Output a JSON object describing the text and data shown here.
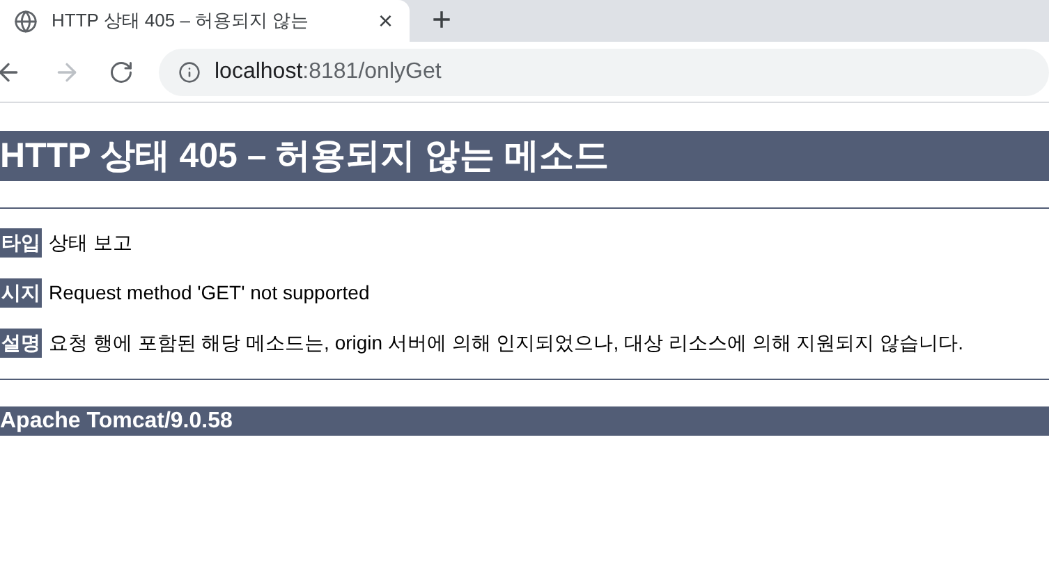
{
  "browser": {
    "tab": {
      "title": "HTTP 상태 405 – 허용되지 않는",
      "close": "×",
      "selected": true
    },
    "new_tab": "+",
    "address": {
      "host": "localhost",
      "rest": ":8181/onlyGet"
    }
  },
  "page": {
    "heading": "HTTP 상태 405 – 허용되지 않는 메소드",
    "fields": [
      {
        "label": "타입",
        "value": "상태 보고"
      },
      {
        "label": "시지",
        "value": "Request method 'GET' not supported"
      },
      {
        "label": "설명",
        "value": "요청 행에 포함된 해당 메소드는, origin 서버에 의해 인지되었으나, 대상 리소스에 의해 지원되지 않습니다."
      }
    ],
    "footer": "Apache Tomcat/9.0.58"
  }
}
